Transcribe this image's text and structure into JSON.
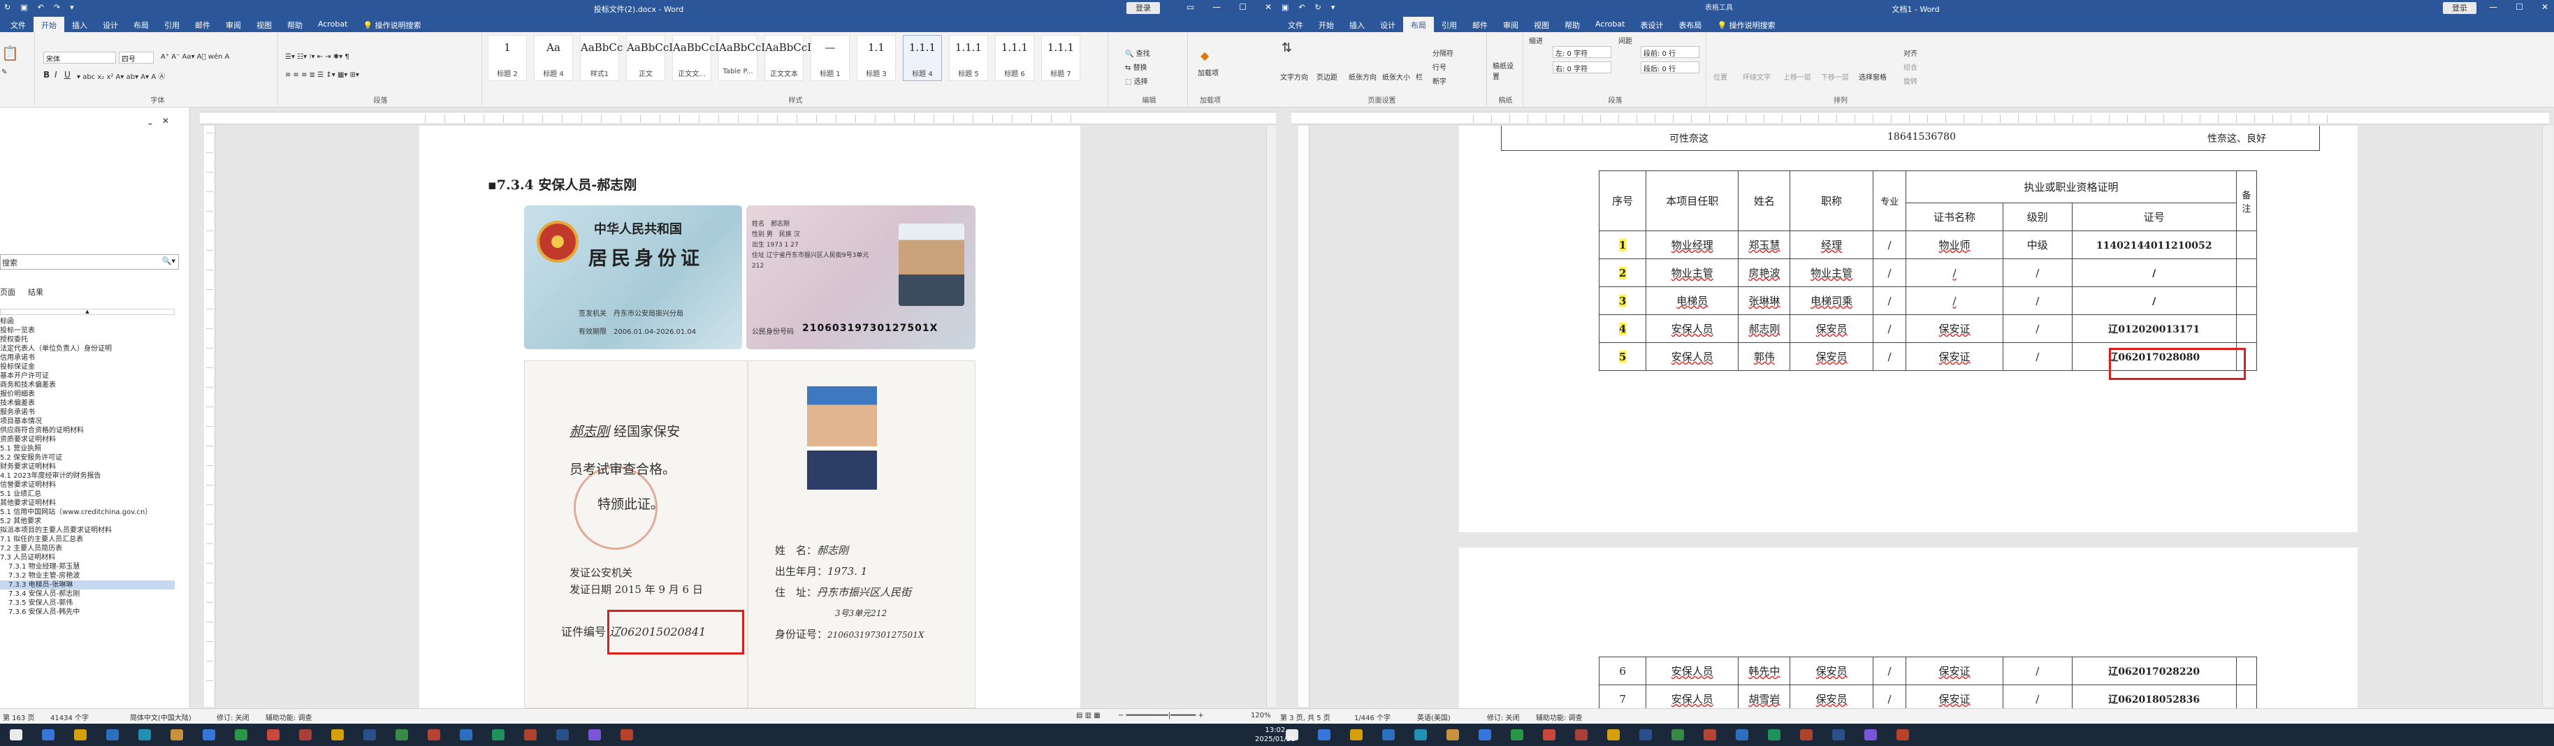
{
  "left_window": {
    "title": "投标文件(2).docx - Word",
    "login": "登录",
    "tabs": [
      "文件",
      "插入",
      "设计",
      "布局",
      "引用",
      "邮件",
      "审阅",
      "视图",
      "帮助",
      "Acrobat",
      "操作说明搜索"
    ],
    "active_tab": "开始",
    "font_name": "宋体",
    "font_size": "四号",
    "groups": [
      "字体",
      "段落",
      "样式",
      "编辑",
      "加载项"
    ],
    "styles": [
      {
        "preview": "1",
        "name": "标题 2"
      },
      {
        "preview": "Aa",
        "name": "标题 4"
      },
      {
        "preview": "AaBbCc",
        "name": "样式1"
      },
      {
        "preview": "AaBbCcD",
        "name": "正文"
      },
      {
        "preview": "AaBbCcI",
        "name": "正文文..."
      },
      {
        "preview": "AaBbCcDc",
        "name": "Table P..."
      },
      {
        "preview": "AaBbCcDc",
        "name": "正文文本"
      },
      {
        "preview": "—",
        "name": "标题 1"
      },
      {
        "preview": "1.1",
        "name": "标题 3"
      },
      {
        "preview": "1.1.1",
        "name": "标题 4"
      },
      {
        "preview": "1.1.1",
        "name": "标题 5"
      },
      {
        "preview": "1.1.1",
        "name": "标题 6"
      },
      {
        "preview": "1.1.1",
        "name": "标题 7"
      }
    ],
    "edit_items": [
      "查找",
      "替换",
      "选择"
    ],
    "addin": "加载项",
    "nav": {
      "search_placeholder": "搜索",
      "tabs": [
        "标题",
        "页面",
        "结果"
      ],
      "items": [
        "标函",
        "投标一览表",
        "授权委托",
        "法定代表人（单位负责人）身份证明",
        "信用承诺书",
        "投标保证金",
        "基本开户许可证",
        "商务和技术偏差表",
        "报价明细表",
        "技术偏差表",
        "服务承诺书",
        "项目基本情况",
        "供应商符合资格的证明材料",
        "资质要求证明材料",
        "5.1 营业执照",
        "5.2 保安服务许可证",
        "财务要求证明材料",
        "4.1 2023年度经审计的财务报告",
        "信誉要求证明材料",
        "5.1 业绩汇总",
        "其他要求证明材料",
        "5.1 信用中国网站（www.creditchina.gov.cn）",
        "5.2 其他要求",
        "拟派本项目的主要人员要求证明材料",
        "7.1 拟任的主要人员汇总表",
        "7.2 主要人员简历表",
        "7.3 人员证明材料",
        "7.3.1 物业经理-郑玉慧",
        "7.3.2 物业主管-房艳波",
        "7.3.3 电梯员-张琳琳",
        "7.3.4 安保人员-郝志刚",
        "7.3.5 安保人员-郭伟",
        "7.3.6 安保人员-韩先中"
      ],
      "selected_index": 29
    },
    "heading": "7.3.4  安保人员-郝志刚",
    "id_front": {
      "country": "中华人民共和国",
      "title": "居民身份证",
      "issuer_label": "签发机关",
      "issuer": "丹东市公安局振兴分局",
      "valid_label": "有效期限",
      "valid": "2006.01.04-2026.01.04"
    },
    "id_back": {
      "name": "郝志刚",
      "sex": "男",
      "ethnicity": "汉",
      "birth": "1973 1 27",
      "address": "辽宁省丹东市振兴区人民街9号3单元212",
      "id_label": "公民身份号码",
      "id_number": "21060319730127501X"
    },
    "cert": {
      "text1": "经国家保安",
      "text2": "员考试审查合格。",
      "text3": "特颁此证。",
      "issuer": "发证公安机关",
      "date": "发证日期 2015 年 9 月 6 日",
      "number_label": "证件编号",
      "number": "辽062015020841",
      "name_label": "姓　名",
      "name_hw": "郝志刚",
      "birth_label": "出生年月",
      "birth_hw": "1973. 1",
      "addr_label": "住　址",
      "addr_hw": "丹东市振兴区人民街",
      "addr_hw2": "3号3单元212",
      "idno_label": "身份证号",
      "idno_hw": "21060319730127501X"
    },
    "status": [
      "第 163 页",
      "41434 个字",
      "简体中文(中国大陆)",
      "修订: 关闭",
      "辅助功能: 调查"
    ],
    "zoom": "120%"
  },
  "right_window": {
    "title": "文档1 - Word",
    "tool_title": "表格工具",
    "login": "登录",
    "share": "共享",
    "tabs": [
      "文件",
      "开始",
      "插入",
      "设计",
      "布局",
      "引用",
      "邮件",
      "审阅",
      "视图",
      "帮助",
      "Acrobat",
      "表设计",
      "表布局",
      "操作说明搜索"
    ],
    "active_tab": "布局",
    "groups": [
      "页面设置",
      "稿纸",
      "段落",
      "排列"
    ],
    "indent": {
      "label": "缩进",
      "left": "左: 0 字符",
      "right": "右: 0 字符"
    },
    "spacing": {
      "label": "间距",
      "before": "段前: 0 行",
      "after": "段后: 0 行"
    },
    "layout_buttons": [
      "文字方向",
      "页边距",
      "纸张方向",
      "纸张大小",
      "栏",
      "分隔符",
      "行号",
      "断字",
      "稿纸设置",
      "位置",
      "环绕文字",
      "上移一层",
      "下移一层",
      "选择窗格",
      "对齐",
      "组合",
      "旋转"
    ],
    "prev_row_text": [
      "可性奈这",
      "18641536780",
      "性奈这、良好"
    ],
    "table_header": {
      "seq": "序号",
      "role": "本项目任职",
      "name": "姓名",
      "title": "职称",
      "major": "专业",
      "qual": "执业或职业资格证明",
      "cert_name": "证书名称",
      "level": "级别",
      "cert_no": "证号",
      "note": "备注"
    },
    "rows": [
      {
        "seq": "1",
        "role": "物业经理",
        "name": "郑玉慧",
        "title": "经理",
        "major": "/",
        "cert": "物业师",
        "level": "中级",
        "no": "11402144011210052"
      },
      {
        "seq": "2",
        "role": "物业主管",
        "name": "房艳波",
        "title": "物业主管",
        "major": "/",
        "cert": "/",
        "level": "/",
        "no": "/"
      },
      {
        "seq": "3",
        "role": "电梯员",
        "name": "张琳琳",
        "title": "电梯司乘",
        "major": "/",
        "cert": "/",
        "level": "/",
        "no": "/"
      },
      {
        "seq": "4",
        "role": "安保人员",
        "name": "郝志刚",
        "title": "保安员",
        "major": "/",
        "cert": "保安证",
        "level": "/",
        "no": "辽012020013171"
      },
      {
        "seq": "5",
        "role": "安保人员",
        "name": "郭伟",
        "title": "保安员",
        "major": "/",
        "cert": "保安证",
        "level": "/",
        "no": "辽062017028080"
      }
    ],
    "rows2": [
      {
        "seq": "6",
        "role": "安保人员",
        "name": "韩先中",
        "title": "保安员",
        "major": "/",
        "cert": "保安证",
        "level": "/",
        "no": "辽062017028220"
      },
      {
        "seq": "7",
        "role": "安保人员",
        "name": "胡雪岩",
        "title": "保安员",
        "major": "/",
        "cert": "保安证",
        "level": "/",
        "no": "辽062018052836"
      }
    ],
    "status": [
      "第 3 页, 共 5 页",
      "1/446 个字",
      "英语(美国)",
      "修订: 关闭",
      "辅助功能: 调查"
    ]
  },
  "taskbar": {
    "time": "13:02",
    "date": "2025/01/21"
  }
}
